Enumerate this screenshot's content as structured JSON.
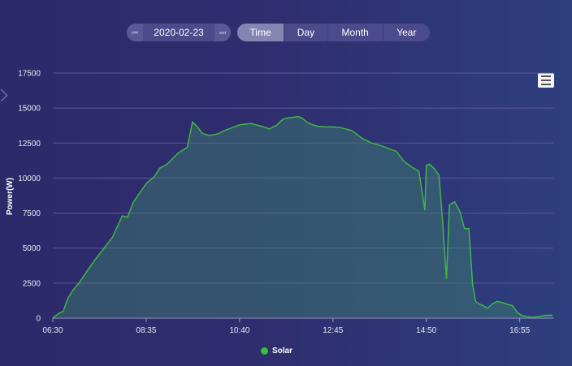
{
  "date_picker": {
    "value": "2020-02-23",
    "prev_icon": "skip-previous-icon",
    "next_icon": "skip-next-icon"
  },
  "period_tabs": [
    {
      "label": "Time",
      "active": true
    },
    {
      "label": "Day",
      "active": false
    },
    {
      "label": "Month",
      "active": false
    },
    {
      "label": "Year",
      "active": false
    }
  ],
  "menu_icon": "hamburger-menu-icon",
  "chart_data": {
    "type": "area",
    "ylabel": "Power(W)",
    "ylim": [
      0,
      17500
    ],
    "y_ticks": [
      "0",
      "2500",
      "5000",
      "7500",
      "10000",
      "12500",
      "15000",
      "17500"
    ],
    "x_ticks": [
      "06:30",
      "08:35",
      "10:40",
      "12:45",
      "14:50",
      "16:55"
    ],
    "xlim": [
      "06:30",
      "17:40"
    ],
    "grid": true,
    "legend_position": "bottom-center",
    "series": [
      {
        "name": "Solar",
        "color": "#3db843",
        "x": [
          "06:30",
          "06:37",
          "06:44",
          "06:50",
          "06:57",
          "07:05",
          "07:15",
          "07:27",
          "07:40",
          "07:50",
          "07:57",
          "08:03",
          "08:10",
          "08:18",
          "08:27",
          "08:35",
          "08:37",
          "08:39",
          "08:46",
          "08:53",
          "09:03",
          "09:18",
          "09:30",
          "09:37",
          "09:43",
          "09:50",
          "09:55",
          "10:00",
          "10:05",
          "10:07",
          "10:13",
          "10:20",
          "10:30",
          "10:40",
          "10:55",
          "11:10",
          "11:20",
          "11:30",
          "11:38",
          "11:45",
          "11:53",
          "11:58",
          "12:03",
          "12:10",
          "12:18",
          "12:25",
          "12:35",
          "12:45",
          "12:55",
          "13:10",
          "13:25",
          "13:37",
          "13:50",
          "14:00",
          "14:10",
          "14:20",
          "14:30",
          "14:40",
          "14:45",
          "14:48",
          "14:50",
          "14:54",
          "15:00",
          "15:07",
          "15:12",
          "15:17",
          "15:21",
          "15:28",
          "15:35",
          "15:41",
          "15:47",
          "15:52",
          "15:56",
          "16:01",
          "16:06",
          "16:12",
          "16:18",
          "16:25",
          "16:32",
          "16:38",
          "16:45",
          "16:52",
          "16:57",
          "17:05",
          "17:12",
          "17:20",
          "17:30",
          "17:39"
        ],
        "y": [
          0,
          300,
          500,
          1400,
          2000,
          2500,
          3300,
          4200,
          5100,
          5800,
          6600,
          7300,
          7200,
          8300,
          9000,
          9600,
          9700,
          9800,
          10100,
          10700,
          11000,
          11800,
          12200,
          14000,
          13700,
          13200,
          13100,
          13050,
          13100,
          13100,
          13200,
          13400,
          13600,
          13800,
          13900,
          13700,
          13500,
          13800,
          14200,
          14300,
          14350,
          14400,
          14300,
          14000,
          13800,
          13700,
          13650,
          13650,
          13600,
          13400,
          12800,
          12500,
          12300,
          12100,
          11900,
          11200,
          10800,
          10500,
          8800,
          7700,
          10900,
          11000,
          10700,
          10200,
          6800,
          2800,
          8100,
          8300,
          7600,
          6400,
          6400,
          2400,
          1200,
          1000,
          900,
          700,
          1000,
          1200,
          1100,
          1000,
          900,
          400,
          200,
          100,
          50,
          100,
          200,
          200
        ]
      }
    ]
  }
}
